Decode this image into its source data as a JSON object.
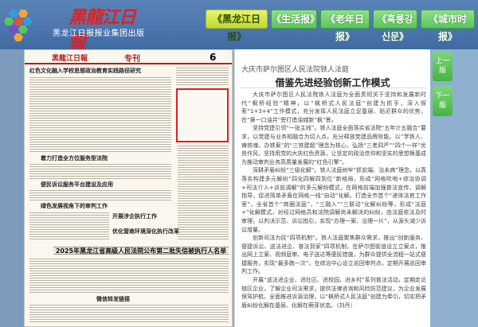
{
  "header": {
    "brand": "黑龍江日報",
    "subtitle": "黑龙江日报报业集团出版",
    "tabs": [
      {
        "label": "《黑龙江日报》",
        "active": true
      },
      {
        "label": "《生活报》",
        "active": false
      },
      {
        "label": "《老年日报》",
        "active": false
      },
      {
        "label": "《흑룡강신문》",
        "active": false
      },
      {
        "label": "《城市时报》",
        "active": false
      }
    ]
  },
  "side_buttons": [
    {
      "icon": "menu-icon",
      "color": "#7b4dc6"
    },
    {
      "icon": "grid-icon",
      "color": "#f4a23a"
    },
    {
      "icon": "list-icon",
      "color": "#e0533e"
    }
  ],
  "paper": {
    "name": "黑龍江日報",
    "section": "专刊",
    "page_number": "6",
    "headlines": [
      "红色文化融入学校思想政治教育实践路径研究",
      "着力打造全方位服务型法院",
      "便民诉讼服务平台建设及应用",
      "绿色发展视角下的审判工作",
      "开展涉企执行工作",
      "优化营商环境深化执行改革"
    ],
    "banner": "2025年黑龙江省高级人民法院公布第二批失信被执行人名单",
    "bottom_title": "微信转发链接"
  },
  "article": {
    "subtitle": "大庆市萨尔图区人民法院铁人法庭",
    "title": "借鉴先进经验创新工作模式",
    "paragraphs": [
      "大庆市萨尔图区人民法院铁人法庭为全面贯彻关于坚持和发展新时代“枫桥经验”精神，以“枫桥式人民法庭”创建为抓手，深入探索“1+3+4”工作模式，充分发挥人民法庭立足基层、贴近群众的优势，在“第一口油井”旁打造油城新“枫”景。",
      "坚持党建引领“一张主线”。铁人法庭全面落实省法院“五年计五融合”要求，以党建与业务相融合为切入点，充分释放党建品牌效能。以“学铁人、铸铁魂、办铁案”的“三铁建超”理念为核心，弘扬“三老四严”“四个一样”优良作风，坚持用党的大庆红色资源，让坚定的政治信仰和坚实的思想根基成为推动审判业务高质量发展的“红色引擎”。",
      "深耕矛盾纠纷“三级化解”。铁人法庭树牢“抓前端、治未病”理念，以真落实构建多元解纷“四化四解四到位”新格局，形成“网格吹哨+综治协调+司法介入+诉前调解”的多元解纷模式，在网格前端加强普法宣传、调解指导，促进简单矛盾在网格一线“自动”化解。打造全市首个“递体法官工作室”，全省首个“商圈法庭”，“三融入”“三联动”化解纠纷等，形成“法庭+”化解模式，对经过网格员和法院调解尚未解决的纠纷，由法庭依法及时审理，以判决示范、诉讼指引，实现“办理一案、治理一片”，从源头减少诉讼增量。",
      "创新司法为民“四项机制”。铁人法庭聚焦群众需求，推出“创新服务、便捷诉讼、送法进企、普法到家”四项机制，在萨尔图街道设立立案点，推出网上立案、视频庭审、电子送达等便民措施，为群众提供全流程一站式便捷服务，实现“最多跑一次”。在综治中心设立巡回审判点，定期开展巡回审判工作。",
      "开展“送法进企业、进社区、进校园、进乡村”系列普法活动，定期走访辖区企业，了解企业司法需求，提供法律咨询和风险防范建议，为企业发展保驾护航。全面推进诉源治理，以“枫桥式人民法庭”创建为牵引，切实把矛盾纠纷化解在基层、化解在萌芽状态。（刘丹）"
    ]
  },
  "page_nav": {
    "prev_label": "上一版",
    "next_label": "下一版"
  },
  "colors": {
    "header_bg": "#4b76ad",
    "tab_green": "#5cc65a",
    "tab_active": "#c2d832",
    "highlight_red": "#e02020"
  }
}
